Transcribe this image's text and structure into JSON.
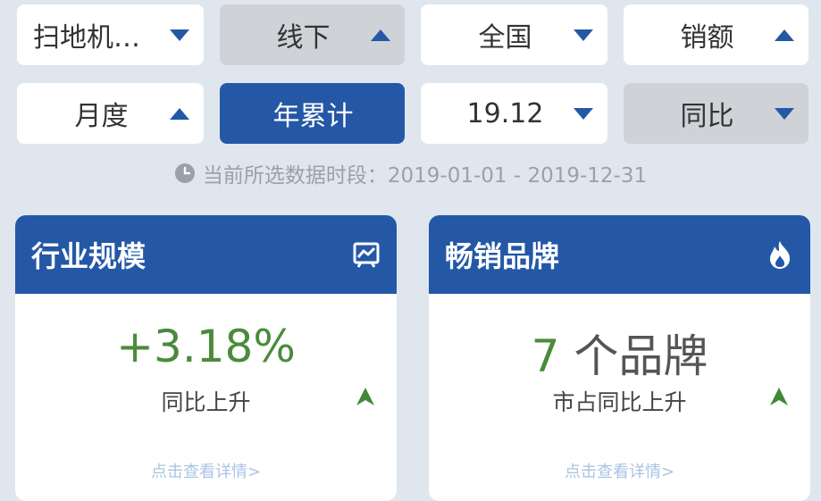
{
  "filters": {
    "row1": [
      {
        "label": "扫地机…",
        "style": "white",
        "caret": "down"
      },
      {
        "label": "线下",
        "style": "gray",
        "caret": "up"
      },
      {
        "label": "全国",
        "style": "white",
        "caret": "down"
      },
      {
        "label": "销额",
        "style": "white",
        "caret": "up"
      }
    ],
    "row2": [
      {
        "label": "月度",
        "style": "white",
        "caret": "up"
      },
      {
        "label": "年累计",
        "style": "blue",
        "caret": "none"
      },
      {
        "label": "19.12",
        "style": "white",
        "caret": "down"
      },
      {
        "label": "同比",
        "style": "gray",
        "caret": "down"
      }
    ]
  },
  "period": {
    "text": "当前所选数据时段：2019-01-01 - 2019-12-31",
    "icon": "clock-icon"
  },
  "cards": {
    "industry": {
      "title": "行业规模",
      "icon": "trend-chart-icon",
      "value": "+3.18%",
      "desc": "同比上升",
      "detail_link": "点击查看详情>"
    },
    "brands": {
      "title": "畅销品牌",
      "icon": "flame-icon",
      "value": "7",
      "value_unit": " 个品牌",
      "desc": "市占同比上升",
      "detail_link": "点击查看详情>"
    }
  },
  "colors": {
    "brand_blue": "#2458a6",
    "positive_green": "#4a8b3b",
    "background": "#dfe6ee"
  }
}
